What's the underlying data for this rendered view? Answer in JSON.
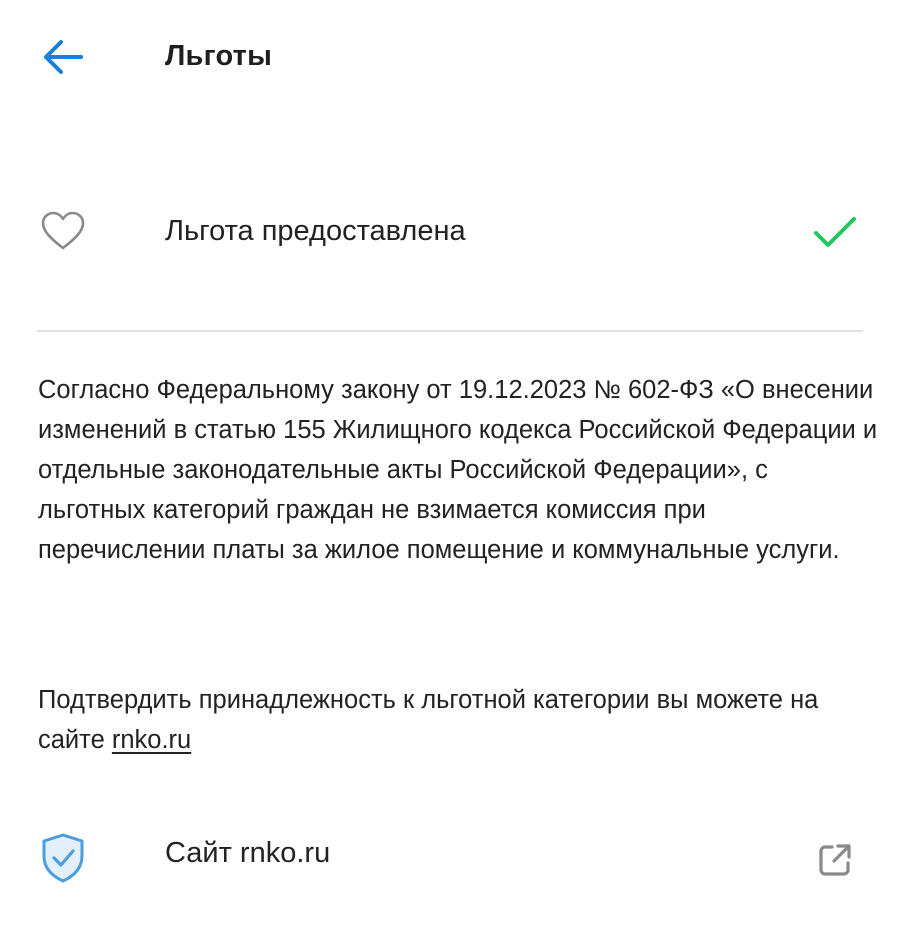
{
  "header": {
    "back_icon": "arrow-left-icon",
    "title": "Льготы"
  },
  "benefit": {
    "icon": "heart-outline-icon",
    "label": "Льгота предоставлена",
    "status_icon": "checkmark-icon"
  },
  "info": {
    "law_text": "Согласно Федеральному закону от 19.12.2023 № 602-ФЗ «О внесении изменений в статью 155 Жилищного кодекса Российской Федерации и отдельные законодательные акты Российской Федерации», с льготных категорий граждан не взимается комиссия при перечислении платы за жилое помещение и коммунальные услуги.",
    "confirm_text_before": "Подтвердить принадлежность к льготной категории вы можете на сайте ",
    "confirm_link": "rnko.ru"
  },
  "site_item": {
    "icon": "shield-check-icon",
    "label": "Сайт rnko.ru",
    "action_icon": "external-link-icon"
  },
  "colors": {
    "accent_blue": "#1a7fd8",
    "check_green": "#22c55e",
    "icon_gray": "#8a8a8a",
    "shield_blue": "#4a9ee0",
    "divider": "#e1e1e1"
  }
}
